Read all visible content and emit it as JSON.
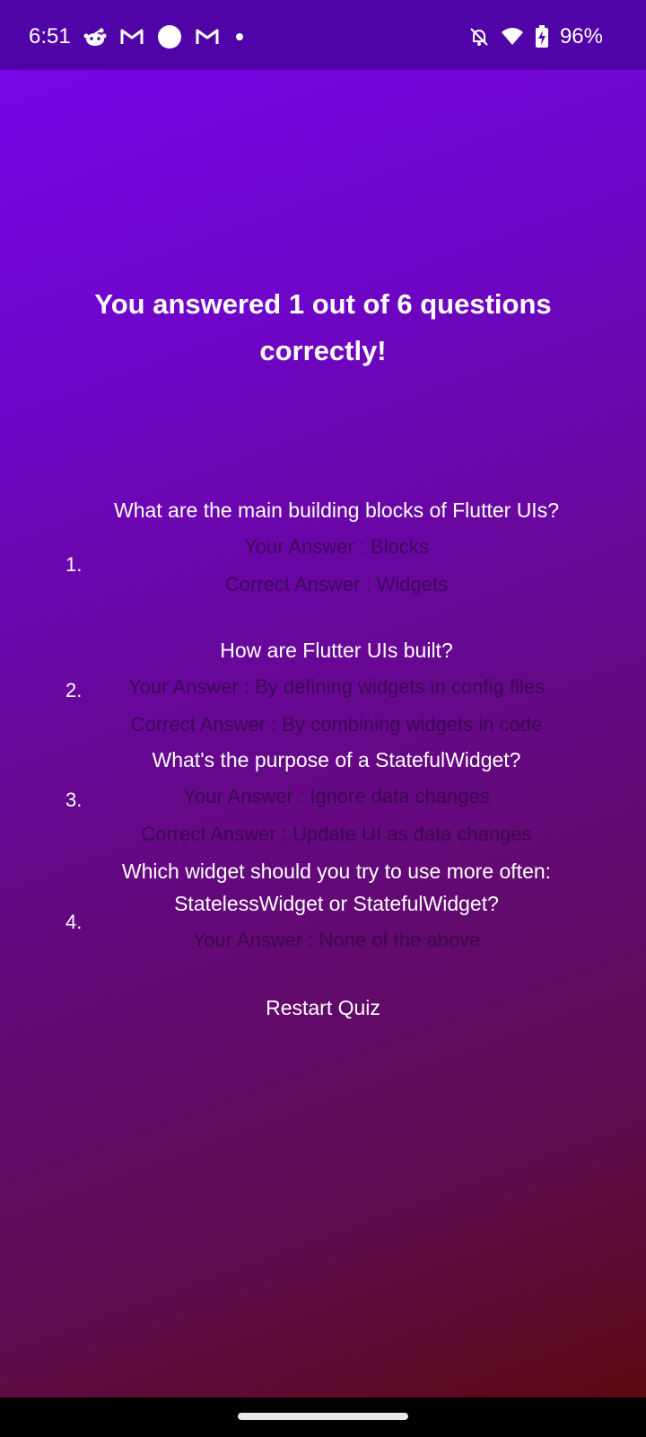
{
  "status_bar": {
    "time": "6:51",
    "battery": "96%",
    "icons_left": [
      "reddit-icon",
      "gmail-icon",
      "circle-icon",
      "gmail-icon",
      "dot-icon"
    ],
    "icons_right": [
      "notifications-off-icon",
      "wifi-icon",
      "battery-charging-icon"
    ]
  },
  "summary": {
    "title": "You answered 1 out of 6  questions correctly!"
  },
  "results": [
    {
      "number": "1.",
      "question": "What are the main building blocks of Flutter UIs?",
      "your_answer": "Your Answer : Blocks",
      "correct_answer": "Correct Answer : Widgets"
    },
    {
      "number": "2.",
      "question": "How are Flutter UIs built?",
      "your_answer": "Your Answer : By defining widgets in config files",
      "correct_answer": "Correct Answer : By combining widgets in code"
    },
    {
      "number": "3.",
      "question": "What's the purpose of a StatefulWidget?",
      "your_answer": "Your Answer : Ignore data changes",
      "correct_answer": "Correct Answer : Update UI as data changes"
    },
    {
      "number": "4.",
      "question": "Which widget should you try to use more often: StatelessWidget or StatefulWidget?",
      "your_answer": "Your Answer : None of the above"
    }
  ],
  "restart_label": "Restart Quiz"
}
